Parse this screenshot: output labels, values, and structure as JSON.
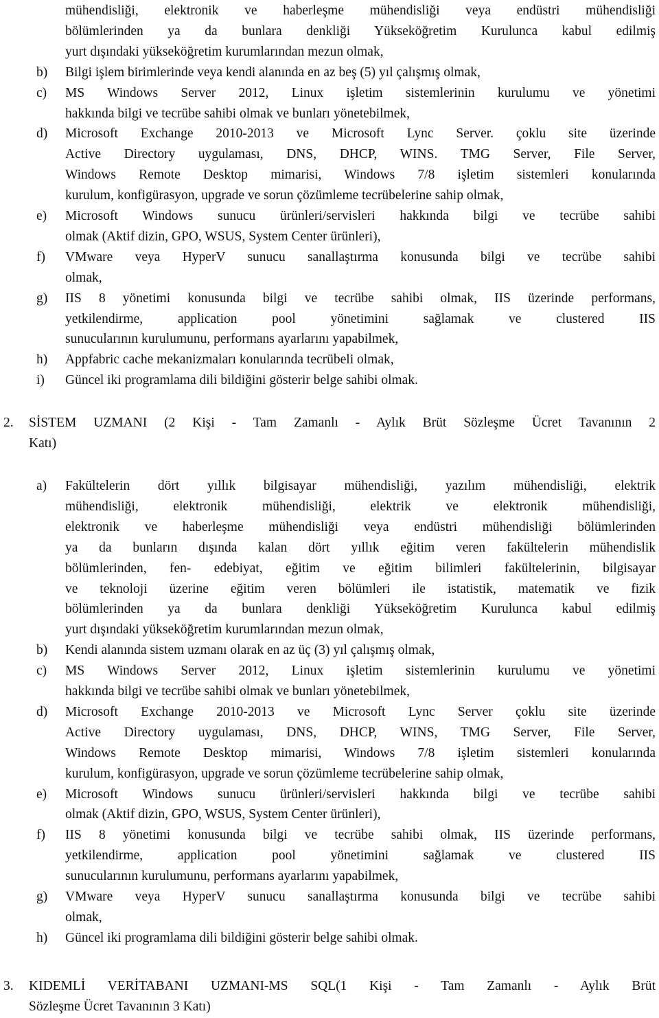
{
  "section1_tail": {
    "a_tail": [
      "mühendisliği, elektronik ve haberleşme mühendisliği veya endüstri mühendisliği",
      "bölümlerinden ya da bunlara denkliği Yükseköğretim Kurulunca kabul edilmiş",
      "yurt dışındaki yükseköğretim kurumlarından mezun olmak,"
    ],
    "items": [
      {
        "label": "b)",
        "lines": [
          "Bilgi işlem birimlerinde veya kendi alanında en az beş (5) yıl çalışmış olmak,"
        ]
      },
      {
        "label": "c)",
        "lines": [
          "MS Windows Server 2012, Linux işletim sistemlerinin kurulumu ve yönetimi",
          "hakkında bilgi ve tecrübe sahibi olmak ve bunları yönetebilmek,"
        ]
      },
      {
        "label": "d)",
        "lines": [
          "Microsoft Exchange 2010-2013 ve Microsoft Lync Server. çoklu site üzerinde",
          "Active Directory uygulaması, DNS, DHCP, WINS. TMG Server, File Server,",
          "Windows Remote Desktop mimarisi, Windows 7/8 işletim sistemleri konularında",
          "kurulum, konfigürasyon, upgrade ve sorun çözümleme tecrübelerine sahip olmak,"
        ]
      },
      {
        "label": "e)",
        "lines": [
          "Microsoft Windows sunucu ürünleri/servisleri hakkında bilgi ve tecrübe sahibi",
          "olmak (Aktif dizin, GPO, WSUS, System Center ürünleri),"
        ]
      },
      {
        "label": "f)",
        "lines": [
          "VMware veya HyperV sunucu sanallaştırma konusunda bilgi ve tecrübe sahibi",
          "olmak,"
        ]
      },
      {
        "label": "g)",
        "lines": [
          "IIS 8 yönetimi konusunda bilgi ve tecrübe sahibi olmak, IIS üzerinde performans,",
          "yetkilendirme, application pool yönetimini sağlamak ve clustered IIS",
          "sunucularının kurulumunu, performans ayarlarını yapabilmek,"
        ]
      },
      {
        "label": "h)",
        "lines": [
          "Appfabric cache mekanizmaları konularında tecrübeli olmak,"
        ]
      },
      {
        "label": "i)",
        "lines": [
          "Güncel iki programlama dili bildiğini gösterir belge sahibi olmak."
        ]
      }
    ]
  },
  "section2": {
    "number": "2.",
    "heading_lines": [
      "SİSTEM UZMANI (2 Kişi - Tam Zamanlı - Aylık Brüt Sözleşme Ücret Tavanının 2",
      "Katı)"
    ],
    "items": [
      {
        "label": "a)",
        "lines": [
          "Fakültelerin dört yıllık bilgisayar mühendisliği, yazılım mühendisliği, elektrik",
          "mühendisliği, elektronik mühendisliği, elektrik ve elektronik mühendisliği,",
          "elektronik ve haberleşme mühendisliği veya endüstri mühendisliği bölümlerinden",
          "ya da bunların dışında kalan dört yıllık eğitim veren fakültelerin mühendislik",
          "bölümlerinden, fen- edebiyat, eğitim ve eğitim bilimleri fakültelerinin, bilgisayar",
          "ve teknoloji üzerine eğitim veren bölümleri ile istatistik, matematik ve fizik",
          "bölümlerinden ya da bunlara denkliği Yükseköğretim Kurulunca kabul edilmiş",
          "yurt dışındaki yükseköğretim kurumlarından mezun olmak,"
        ]
      },
      {
        "label": "b)",
        "lines": [
          "Kendi alanında sistem uzmanı olarak en az üç (3) yıl çalışmış olmak,"
        ]
      },
      {
        "label": "c)",
        "lines": [
          "MS Windows Server 2012, Linux işletim sistemlerinin kurulumu ve yönetimi",
          "hakkında bilgi ve tecrübe sahibi olmak ve bunları yönetebilmek,"
        ]
      },
      {
        "label": "d)",
        "lines": [
          "Microsoft Exchange 2010-2013 ve Microsoft Lync Server çoklu site üzerinde",
          "Active Directory uygulaması, DNS, DHCP, WINS, TMG Server, File Server,",
          "Windows Remote Desktop mimarisi, Windows 7/8 işletim sistemleri konularında",
          "kurulum, konfigürasyon, upgrade ve sorun çözümleme tecrübelerine sahip olmak,"
        ]
      },
      {
        "label": "e)",
        "lines": [
          "Microsoft Windows sunucu ürünleri/servisleri hakkında bilgi ve tecrübe sahibi",
          "olmak (Aktif dizin, GPO, WSUS, System Center ürünleri),"
        ]
      },
      {
        "label": "f)",
        "lines": [
          "IIS 8 yönetimi konusunda bilgi ve tecrübe sahibi olmak, IIS üzerinde performans,",
          "yetkilendirme, application pool yönetimini sağlamak ve clustered IIS",
          "sunucularının kurulumunu, performans ayarlarını yapabilmek,"
        ]
      },
      {
        "label": "g)",
        "lines": [
          "VMware veya HyperV sunucu sanallaştırma konusunda bilgi ve tecrübe sahibi",
          "olmak,"
        ]
      },
      {
        "label": "h)",
        "lines": [
          "Güncel iki programlama dili bildiğini gösterir belge sahibi olmak."
        ]
      }
    ]
  },
  "section3": {
    "number": "3.",
    "heading_lines": [
      "KIDEMLİ VERİTABANI UZMANI-MS SQL(1 Kişi - Tam Zamanlı - Aylık Brüt",
      "Sözleşme Ücret Tavanının 3 Katı)"
    ]
  }
}
